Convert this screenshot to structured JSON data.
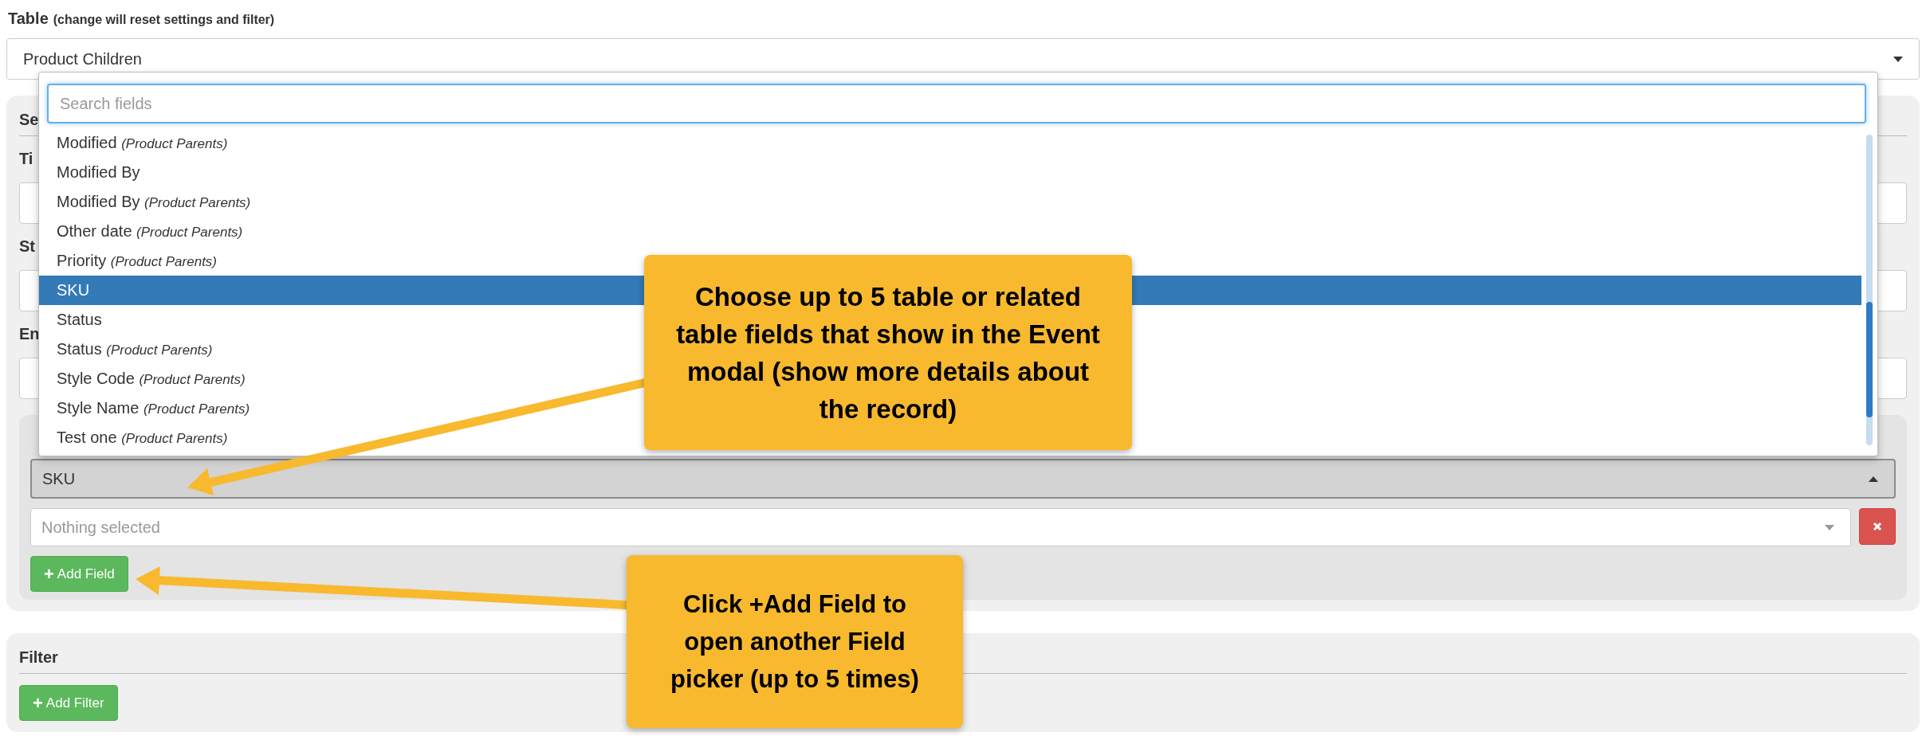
{
  "table": {
    "label": "Table",
    "hint": "(change will reset settings and filter)",
    "value": "Product Children"
  },
  "settings": {
    "heading": "Se",
    "labels": [
      "Ti",
      "St",
      "En"
    ],
    "field_pickers": [
      {
        "value": "SKU",
        "open": true
      },
      {
        "placeholder": "Nothing selected",
        "open": false
      }
    ],
    "add_field": "+ Add Field"
  },
  "dropdown": {
    "search_placeholder": "Search fields",
    "items": [
      {
        "label": "Modified *(Product Parents)*",
        "selected": false
      },
      {
        "label": "Modified By",
        "selected": false
      },
      {
        "label": "Modified By *(Product Parents)*",
        "selected": false
      },
      {
        "label": "Other date *(Product Parents)*",
        "selected": false
      },
      {
        "label": "Priority *(Product Parents)*",
        "selected": false
      },
      {
        "label": "SKU",
        "selected": true
      },
      {
        "label": "Status",
        "selected": false
      },
      {
        "label": "Status *(Product Parents)*",
        "selected": false
      },
      {
        "label": "Style Code *(Product Parents)*",
        "selected": false
      },
      {
        "label": "Style Name *(Product Parents)*",
        "selected": false
      },
      {
        "label": "Test one *(Product Parents)*",
        "selected": false
      }
    ]
  },
  "filter": {
    "heading": "Filter",
    "add_filter": "+ Add Filter"
  },
  "callouts": [
    {
      "text": "Choose up to 5 table or related table fields that show in the Event modal (show more details about the record)"
    },
    {
      "text": "Click +Add Field to open another Field picker (up to 5 times)"
    }
  ]
}
